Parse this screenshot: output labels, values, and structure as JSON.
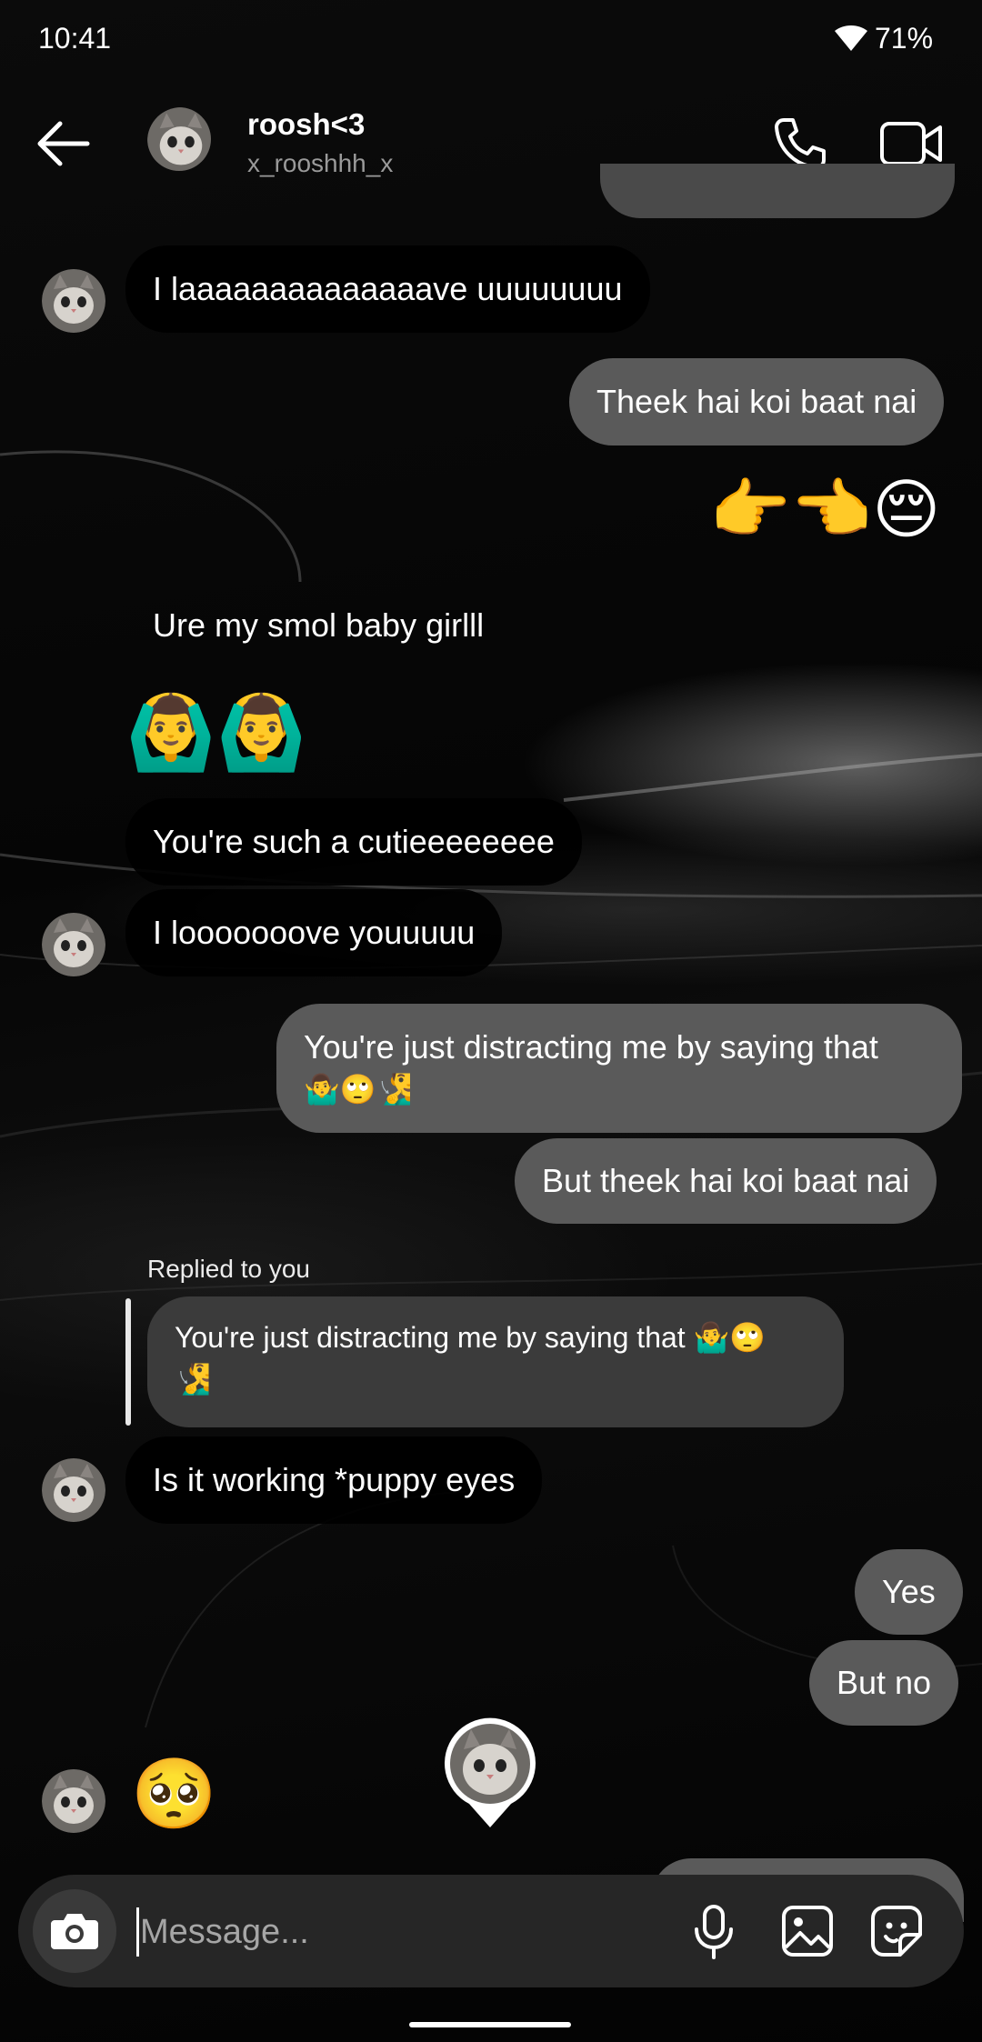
{
  "status_bar": {
    "time": "10:41",
    "battery": "71%"
  },
  "header": {
    "name": "roosh<3",
    "username": "x_rooshhh_x"
  },
  "messages": {
    "m1": "I laaaaaaaaaaaaaave uuuuuuuu",
    "m2": "Theek hai koi baat nai",
    "m3": "👉👈😔",
    "m4": "Ure my smol baby girlll",
    "m5": "🙆‍♂️🙆‍♂️",
    "m6": "You're such a cutieeeeeeee",
    "m7": "I looooooove youuuuu",
    "m8_text": "You're just distracting me by saying that",
    "m8_emoji": "🤷‍♂️🙄🧏‍♂️",
    "m9": "But theek hai koi baat nai",
    "reply_label": "Replied to you",
    "reply_quote_text": "You're just distracting me by saying that 🤷‍♂️🙄",
    "reply_quote_emoji": "🧏‍♂️",
    "m10": "Is it working *puppy eyes",
    "m11": "Yes",
    "m12": "But no",
    "m13": "🥺"
  },
  "composer": {
    "placeholder": "Message..."
  },
  "icons": [
    "wifi-icon",
    "back-arrow-icon",
    "phone-icon",
    "video-camera-icon",
    "camera-icon",
    "microphone-icon",
    "gallery-icon",
    "sticker-icon"
  ]
}
